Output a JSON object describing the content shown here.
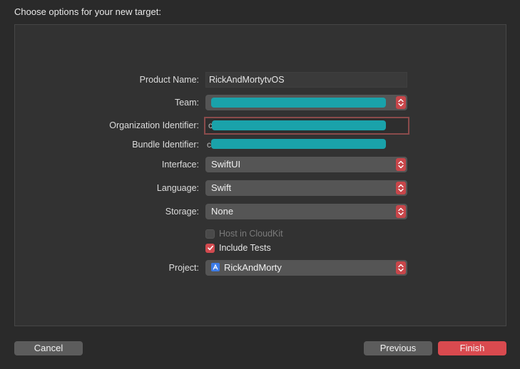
{
  "sheet": {
    "title": "Choose options for your new target:"
  },
  "form": {
    "product_name": {
      "label": "Product Name:",
      "value": "RickAndMortytvOS"
    },
    "team": {
      "label": "Team:",
      "value": ""
    },
    "organization_identifier": {
      "label": "Organization Identifier:",
      "prefix": "c",
      "value": ""
    },
    "bundle_identifier": {
      "label": "Bundle Identifier:",
      "prefix": "c",
      "value": ""
    },
    "interface": {
      "label": "Interface:",
      "value": "SwiftUI"
    },
    "language": {
      "label": "Language:",
      "value": "Swift"
    },
    "storage": {
      "label": "Storage:",
      "value": "None"
    },
    "host_in_cloudkit": {
      "label": "Host in CloudKit",
      "checked": false,
      "enabled": false
    },
    "include_tests": {
      "label": "Include Tests",
      "checked": true,
      "enabled": true
    },
    "project": {
      "label": "Project:",
      "value": "RickAndMorty",
      "icon": "project-icon"
    }
  },
  "buttons": {
    "cancel": "Cancel",
    "previous": "Previous",
    "finish": "Finish"
  },
  "colors": {
    "accent": "#d94a4f",
    "redaction": "#1aa2aa"
  }
}
